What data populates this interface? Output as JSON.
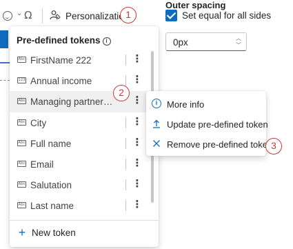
{
  "toolbar": {
    "icons": [
      "emoji-icon",
      "chevron-down-icon",
      "omega-icon",
      "personalization-icon"
    ],
    "personalization_label": "Personalization",
    "step1": "1"
  },
  "right_panel": {
    "outer_spacing_label": "Outer spacing",
    "set_equal_label": "Set equal for all sides",
    "set_equal_checked": true,
    "spacing_value": "0px"
  },
  "tokens_menu": {
    "header": "Pre-defined tokens",
    "header_info_glyph": "i",
    "tokens": [
      {
        "label": "FirstName 222",
        "type_badge": "Abc"
      },
      {
        "label": "Annual income",
        "type_badge": "123"
      },
      {
        "label": "Managing partner co...",
        "type_badge": "Abc"
      },
      {
        "label": "City",
        "type_badge": "Abc"
      },
      {
        "label": "Full name",
        "type_badge": "Abc"
      },
      {
        "label": "Email",
        "type_badge": "Abc"
      },
      {
        "label": "Salutation",
        "type_badge": "Abc"
      },
      {
        "label": "Last name",
        "type_badge": "Abc"
      }
    ],
    "more_glyph": "⋮",
    "new_token_label": "New token",
    "step2": "2"
  },
  "context_menu": {
    "items": [
      {
        "label": "More info",
        "icon": "info-icon"
      },
      {
        "label": "Update pre-defined token",
        "icon": "upload-icon"
      },
      {
        "label": "Remove pre-defined token",
        "icon": "close-icon"
      }
    ],
    "step3": "3"
  },
  "colors": {
    "accent": "#0f6cbd",
    "callout_red": "#d13438",
    "highlight_row": "#f0f0f0"
  }
}
